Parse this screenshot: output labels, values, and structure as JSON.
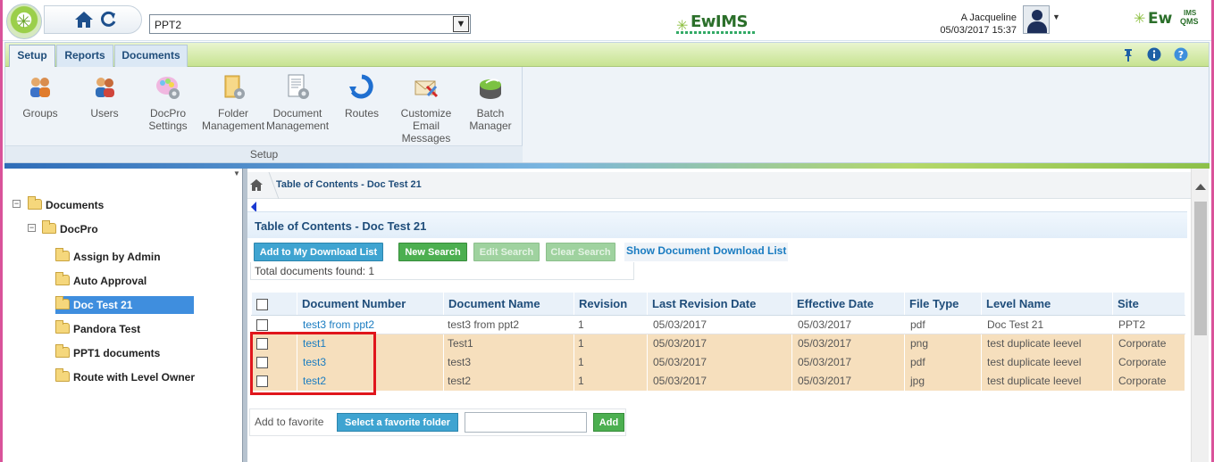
{
  "header": {
    "site_selected": "PPT2",
    "center_logo": "EwIMS",
    "right_logo_main": "Ew",
    "right_logo_sup": "IMS",
    "right_logo_sub": "QMS",
    "user_name": "A Jacqueline",
    "datetime": "05/03/2017 15:37"
  },
  "ribbon": {
    "tabs": [
      "Setup",
      "Reports",
      "Documents"
    ],
    "active_tab": "Setup",
    "buttons": [
      {
        "line1": "Groups",
        "line2": "",
        "line3": "",
        "icon": "groups-icon"
      },
      {
        "line1": "Users",
        "line2": "",
        "line3": "",
        "icon": "users-icon"
      },
      {
        "line1": "DocPro",
        "line2": "Settings",
        "line3": "",
        "icon": "docpro-settings-icon"
      },
      {
        "line1": "Folder",
        "line2": "Management",
        "line3": "",
        "icon": "folder-management-icon"
      },
      {
        "line1": "Document",
        "line2": "Management",
        "line3": "",
        "icon": "document-management-icon"
      },
      {
        "line1": "Routes",
        "line2": "",
        "line3": "",
        "icon": "routes-icon"
      },
      {
        "line1": "Customize",
        "line2": "Email",
        "line3": "Messages",
        "icon": "email-messages-icon"
      },
      {
        "line1": "Batch",
        "line2": "Manager",
        "line3": "",
        "icon": "batch-manager-icon"
      }
    ],
    "group_label": "Setup",
    "right_icons": [
      "pin-icon",
      "info-icon",
      "help-icon"
    ]
  },
  "tree": {
    "root": "Documents",
    "child": "DocPro",
    "items": [
      "Assign by Admin",
      "Auto Approval",
      "Doc Test 21",
      "Pandora Test",
      "PPT1 documents",
      "Route with Level Owner"
    ],
    "selected": "Doc Test 21"
  },
  "content": {
    "breadcrumb": "Table of Contents - Doc Test 21",
    "title": "Table of Contents - Doc Test 21",
    "buttons": {
      "add_download": "Add to My Download List",
      "new_search": "New Search",
      "edit_search": "Edit Search",
      "clear_search": "Clear Search",
      "show_download": "Show Document Download List"
    },
    "total": "Total documents found: 1",
    "columns": [
      "Document Number",
      "Document Name",
      "Revision",
      "Last Revision Date",
      "Effective Date",
      "File Type",
      "Level Name",
      "Site"
    ],
    "rows": [
      {
        "number": "test3 from ppt2",
        "name": "test3 from ppt2",
        "revision": "1",
        "last_rev": "05/03/2017",
        "effective": "05/03/2017",
        "file_type": "pdf",
        "level": "Doc Test 21",
        "site": "PPT2"
      },
      {
        "number": "test1",
        "name": "Test1",
        "revision": "1",
        "last_rev": "05/03/2017",
        "effective": "05/03/2017",
        "file_type": "png",
        "level": "test duplicate leevel",
        "site": "Corporate"
      },
      {
        "number": "test3",
        "name": "test3",
        "revision": "1",
        "last_rev": "05/03/2017",
        "effective": "05/03/2017",
        "file_type": "pdf",
        "level": "test duplicate leevel",
        "site": "Corporate"
      },
      {
        "number": "test2",
        "name": "test2",
        "revision": "1",
        "last_rev": "05/03/2017",
        "effective": "05/03/2017",
        "file_type": "jpg",
        "level": "test duplicate leevel",
        "site": "Corporate"
      }
    ],
    "favorite": {
      "label": "Add to favorite",
      "select_btn": "Select a favorite folder",
      "input_value": "",
      "add_btn": "Add"
    }
  },
  "colors": {
    "accent_blue": "#3fa4d1",
    "accent_green": "#4caf50",
    "highlight_row": "#f6dfbd",
    "annotation_red": "#e0161c"
  }
}
